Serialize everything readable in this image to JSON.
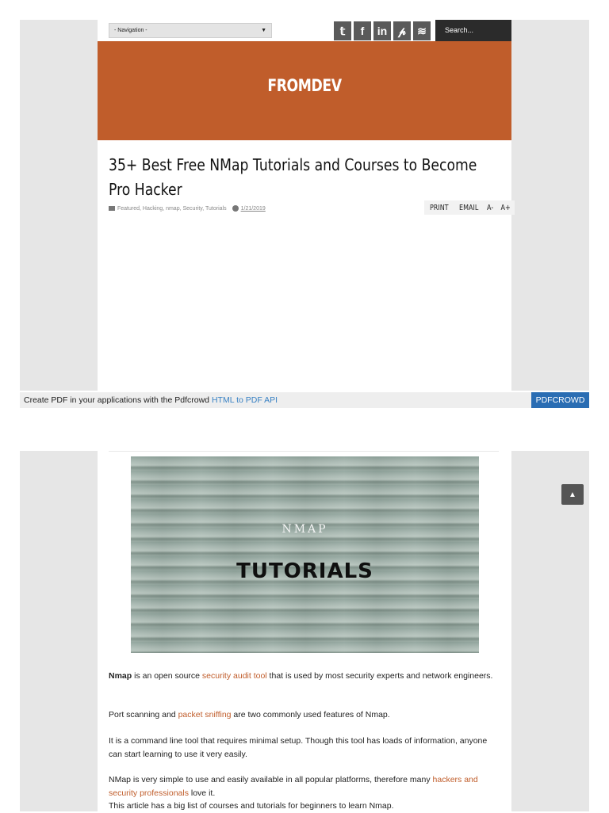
{
  "topbar": {
    "nav_select": "- Navigation -",
    "social": [
      "twitter-icon",
      "facebook-icon",
      "linkedin-icon",
      "pinterest-icon",
      "rss-icon"
    ],
    "social_glyphs": [
      "𝕥",
      "f",
      "in",
      "𝓅",
      "≋"
    ],
    "search_placeholder": "Search..."
  },
  "header": {
    "site_title": "FROMDEV",
    "band_color": "#c05d2b"
  },
  "post": {
    "title": "35+ Best Free NMap Tutorials and Courses to Become Pro Hacker",
    "categories": "Featured, Hacking, nmap, Security, Tutorials",
    "date": "1/21/2019",
    "tools": [
      "PRINT",
      "EMAIL",
      "A-",
      "A+"
    ]
  },
  "pdfcrowd": {
    "text": "Create PDF in your applications with the Pdfcrowd ",
    "link": "HTML to PDF API",
    "button": "PDFCROWD"
  },
  "hero": {
    "line1": "NMAP",
    "line2": "TUTORIALS"
  },
  "article": {
    "p1_bold": "Nmap",
    "p1_a": " is an open source ",
    "p1_link": "security audit tool",
    "p1_b": " that is used by most security experts and network engineers.",
    "p2_a": "Port scanning and ",
    "p2_link": "packet sniffing",
    "p2_b": " are two commonly used features of Nmap.",
    "p3": "It is a command line tool that requires minimal setup. Though this tool has loads of information, anyone can start learning to use it very easily.",
    "p4_a": "NMap is very simple to use and easily available in all popular platforms, therefore many ",
    "p4_link": "hackers and security professionals",
    "p4_b": " love it.",
    "p5": "This article has a big list of courses and tutorials for beginners to learn Nmap."
  },
  "scroll_top_icon": "chevron-up-icon"
}
